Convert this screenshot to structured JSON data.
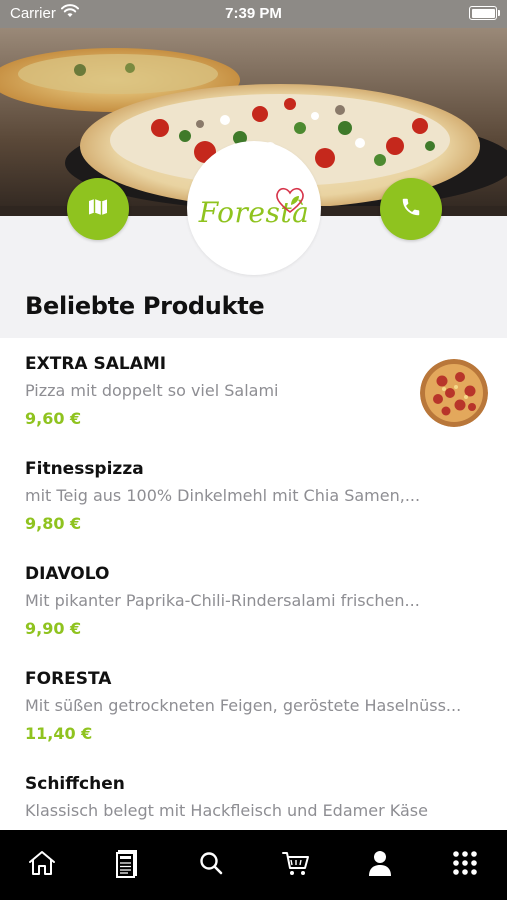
{
  "status_bar": {
    "carrier": "Carrier",
    "time": "7:39 PM"
  },
  "brand": {
    "logo_text": "Forestà",
    "accent": "#8fc31f"
  },
  "section": {
    "title": "Beliebte Produkte"
  },
  "products": [
    {
      "name": "EXTRA SALAMI",
      "description": "Pizza mit doppelt so viel Salami",
      "price": "9,60 €",
      "has_image": true
    },
    {
      "name": "Fitnesspizza",
      "description": "mit Teig aus 100% Dinkelmehl mit Chia Samen,...",
      "price": "9,80 €"
    },
    {
      "name": "DIAVOLO",
      "description": "Mit pikanter Paprika-Chili-Rindersalami frischen...",
      "price": "9,90 €"
    },
    {
      "name": "FORESTA",
      "description": "Mit süßen getrockneten Feigen, geröstete Haselnüss...",
      "price": "11,40 €"
    },
    {
      "name": "Schiffchen",
      "description": "Klassisch belegt mit Hackfleisch und Edamer Käse",
      "price": ""
    }
  ],
  "tabs": [
    {
      "icon": "home-icon"
    },
    {
      "icon": "menu-card-icon"
    },
    {
      "icon": "search-icon"
    },
    {
      "icon": "cart-icon"
    },
    {
      "icon": "account-icon"
    },
    {
      "icon": "grid-more-icon"
    }
  ]
}
